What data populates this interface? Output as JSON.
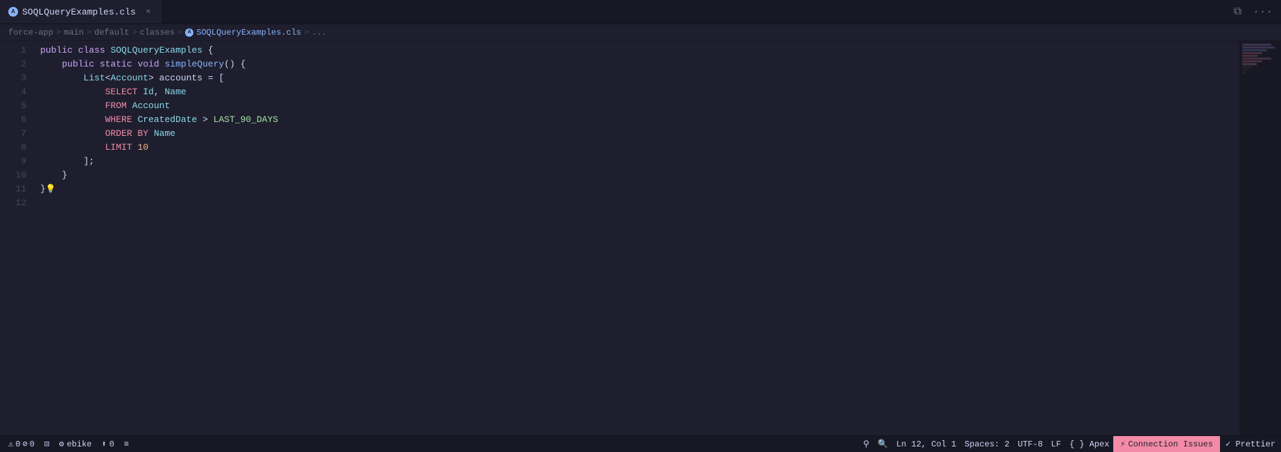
{
  "tab": {
    "filename": "SOQLQueryExamples.cls",
    "close_label": "×",
    "icon_label": "A"
  },
  "breadcrumb": {
    "items": [
      {
        "label": "force-app",
        "type": "folder"
      },
      {
        "label": "main",
        "type": "folder"
      },
      {
        "label": "default",
        "type": "folder"
      },
      {
        "label": "classes",
        "type": "folder"
      },
      {
        "label": "SOQLQueryExamples.cls",
        "type": "apex"
      },
      {
        "label": "...",
        "type": "text"
      }
    ],
    "separators": [
      ">",
      ">",
      ">",
      ">",
      ">"
    ]
  },
  "code": {
    "lines": [
      {
        "num": "1",
        "content": "public_class_SOQLQueryExamples_{"
      },
      {
        "num": "2",
        "content": "    public_static_void_simpleQuery()_{"
      },
      {
        "num": "3",
        "content": "        List<Account>_accounts_=_["
      },
      {
        "num": "4",
        "content": "            SELECT_Id,_Name"
      },
      {
        "num": "5",
        "content": "            FROM_Account"
      },
      {
        "num": "6",
        "content": "            WHERE_CreatedDate_>_LAST_90_DAYS"
      },
      {
        "num": "7",
        "content": "            ORDER_BY_Name"
      },
      {
        "num": "8",
        "content": "            LIMIT_10"
      },
      {
        "num": "9",
        "content": "        ];"
      },
      {
        "num": "10",
        "content": "    }"
      },
      {
        "num": "11",
        "content": "}"
      },
      {
        "num": "12",
        "content": ""
      }
    ]
  },
  "status_bar": {
    "warnings": "0",
    "errors": "0",
    "org_label": "ebike",
    "deploy_count": "0",
    "menu_icon": "≡",
    "cursor_pos": "Ln 12, Col 1",
    "spaces": "Spaces: 2",
    "encoding": "UTF-8",
    "line_ending": "LF",
    "language": "{ } Apex",
    "connection_label": "Connection Issues",
    "prettier_label": "✓ Prettier",
    "search_icon": "⚲",
    "zoom_icon": "🔍"
  },
  "colors": {
    "bg": "#1e1e2e",
    "tab_bg": "#181825",
    "accent_blue": "#89b4fa",
    "accent_purple": "#cba6f7",
    "accent_cyan": "#89dceb",
    "accent_red": "#f38ba8",
    "accent_green": "#a6e3a1",
    "accent_orange": "#fab387",
    "accent_yellow": "#f9e2af",
    "text_dim": "#6c7086",
    "connection_bg": "#f38ba8"
  }
}
